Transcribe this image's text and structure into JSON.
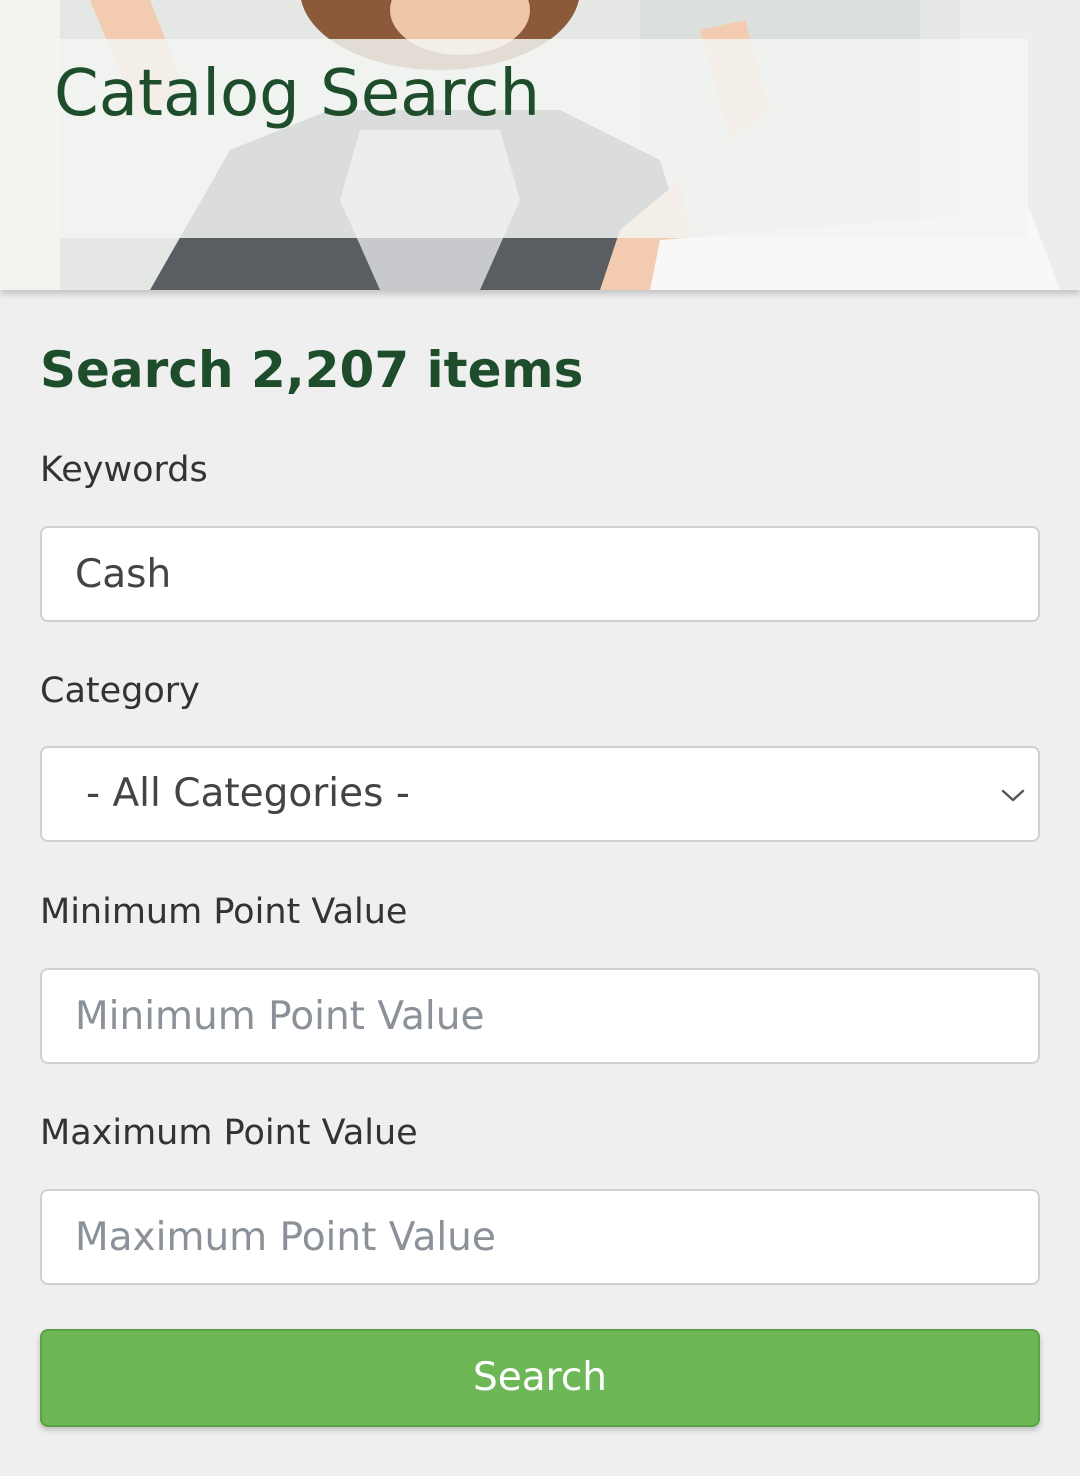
{
  "hero": {
    "title": "Catalog Search"
  },
  "form": {
    "heading": "Search 2,207 items",
    "keywords": {
      "label": "Keywords",
      "value": "Cash"
    },
    "category": {
      "label": "Category",
      "selected": "- All Categories -"
    },
    "min_points": {
      "label": "Minimum Point Value",
      "placeholder": "Minimum Point Value",
      "value": ""
    },
    "max_points": {
      "label": "Maximum Point Value",
      "placeholder": "Maximum Point Value",
      "value": ""
    },
    "submit_label": "Search"
  },
  "colors": {
    "brand_green_dark": "#1e4d2b",
    "button_green": "#6db757",
    "page_background": "#efefef"
  },
  "icons": {
    "category_dropdown": "chevron-down-icon"
  }
}
